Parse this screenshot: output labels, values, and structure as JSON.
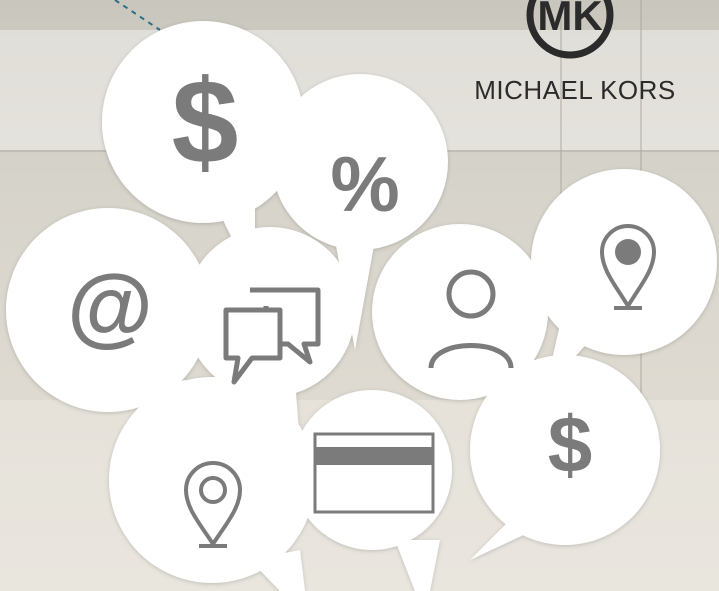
{
  "brand": {
    "name": "MICHAEL KORS",
    "mark": "MK"
  },
  "bubbles": {
    "dollar_large": {
      "glyph": "$",
      "icon": "dollar-icon"
    },
    "percent": {
      "glyph": "%",
      "icon": "percent-icon"
    },
    "at": {
      "glyph": "@",
      "icon": "at-sign-icon"
    },
    "chat": {
      "icon": "chat-bubbles-icon"
    },
    "person": {
      "icon": "person-icon"
    },
    "pin_filled": {
      "icon": "map-pin-filled-icon"
    },
    "pin_outline": {
      "icon": "map-pin-outline-icon"
    },
    "card": {
      "icon": "credit-card-icon"
    },
    "dollar_small": {
      "glyph": "$",
      "icon": "dollar-icon"
    }
  },
  "colors": {
    "bubble": "#ffffff",
    "icon": "#7b7b7b",
    "dash": "#2b6f86",
    "brand": "#2b2b2b"
  }
}
